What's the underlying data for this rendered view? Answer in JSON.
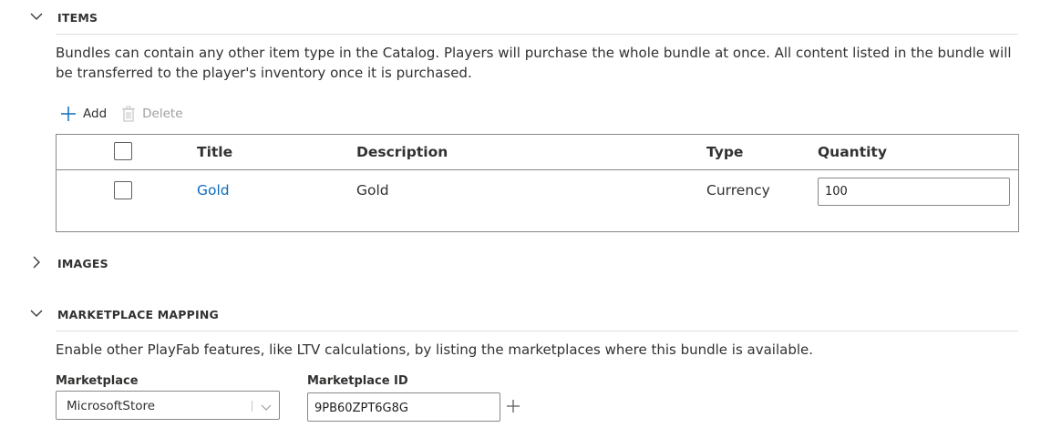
{
  "items_section": {
    "title": "ITEMS",
    "expanded": true,
    "description": "Bundles can contain any other item type in the Catalog. Players will purchase the whole bundle at once. All content listed in the bundle will be transferred to the player's inventory once it is purchased.",
    "toolbar": {
      "add_label": "Add",
      "add_icon": "plus-icon",
      "delete_label": "Delete",
      "delete_icon": "trash-icon"
    },
    "table": {
      "columns": [
        "Title",
        "Description",
        "Type",
        "Quantity"
      ],
      "rows": [
        {
          "title": "Gold",
          "description": "Gold",
          "type": "Currency",
          "quantity": "100",
          "checked": false
        }
      ]
    }
  },
  "images_section": {
    "title": "IMAGES",
    "expanded": false
  },
  "marketplace_section": {
    "title": "MARKETPLACE MAPPING",
    "expanded": true,
    "description": "Enable other PlayFab features, like LTV calculations, by listing the marketplaces where this bundle is available.",
    "marketplace_label": "Marketplace",
    "marketplace_value": "MicrosoftStore",
    "marketplace_id_label": "Marketplace ID",
    "marketplace_id_value": "9PB60ZPT6G8G"
  },
  "colors": {
    "link": "#0f6cbd",
    "border": "#8a8886",
    "divider": "#e1dfdd",
    "disabled": "#a19f9d"
  }
}
